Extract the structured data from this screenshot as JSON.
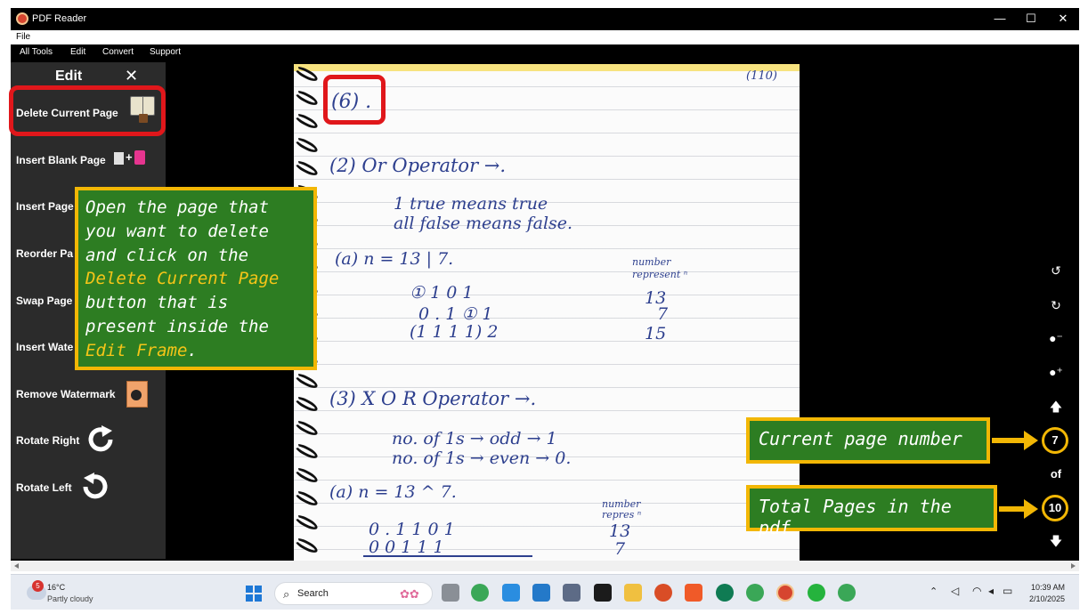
{
  "window": {
    "title": "PDF Reader",
    "controls": {
      "minimize": "—",
      "maximize": "☐",
      "close": "✕"
    }
  },
  "menu": {
    "file": "File"
  },
  "toolbar": {
    "items": [
      "All Tools",
      "Edit",
      "Convert",
      "Support"
    ]
  },
  "sidebar": {
    "title": "Edit",
    "close": "✕",
    "items": [
      {
        "label": "Delete Current Page",
        "icon": "book-delete-icon"
      },
      {
        "label": "Insert Blank Page",
        "icon": "blank-page-plus-icon"
      },
      {
        "label": "Insert Page",
        "icon": "insert-page-icon"
      },
      {
        "label": "Reorder Pa",
        "icon": "reorder-icon"
      },
      {
        "label": "Swap Page",
        "icon": "swap-icon"
      },
      {
        "label": "Insert Wate",
        "icon": "watermark-icon"
      },
      {
        "label": "Remove Watermark",
        "icon": "remove-watermark-icon"
      },
      {
        "label": "Rotate Right",
        "icon": "rotate-right-icon"
      },
      {
        "label": "Rotate Left",
        "icon": "rotate-left-icon"
      }
    ]
  },
  "callouts": {
    "main": {
      "l1": "Open the page that",
      "l2": "you want to delete",
      "l3": "and click on the",
      "l4": "Delete Current Page",
      "l5": "button that is",
      "l6": "present inside the",
      "l7a": "Edit Frame",
      "l7b": "."
    },
    "current": "Current page number",
    "total": "Total Pages in the pdf"
  },
  "pager": {
    "current": "7",
    "of": "of",
    "total": "10"
  },
  "notebook": {
    "corner": "(110)",
    "six": "(6) .",
    "s2": "(2)   Or   Operator →.",
    "l1": "1  true   means  true",
    "l2": "all  false   means   false.",
    "a1": "(a)   n =  13  |  7.",
    "nr1": "number",
    "nr2": "represent ⁿ",
    "b1": "①   1    0   1",
    "b2": "0 .  1   ①  1",
    "b3": "(1    1    1    1) 2",
    "v13": "13",
    "v7": "7",
    "v15": "15",
    "s3": "(3)   X O R   Operator →.",
    "x1": "no. of  1s →  odd  →  1",
    "x2": "no. of  1s →  even →  0.",
    "a2": "(a)   n =  13  ^ 7.",
    "nr3": "number",
    "nr4": "repres ⁿ",
    "c1": "0 . 1   1   0   1",
    "c2": "0   0   1   1   1",
    "c13": "13",
    "c7": "7"
  },
  "taskbar": {
    "temp": "16°C",
    "weather": "Partly cloudy",
    "badge": "5",
    "search": "Search",
    "time": "10:39 AM",
    "date": "2/10/2025"
  },
  "colors": {
    "accent": "#f2b705",
    "callout_bg": "#2d7d22",
    "highlight_red": "#e0171b",
    "ink": "#2d3f8e"
  }
}
